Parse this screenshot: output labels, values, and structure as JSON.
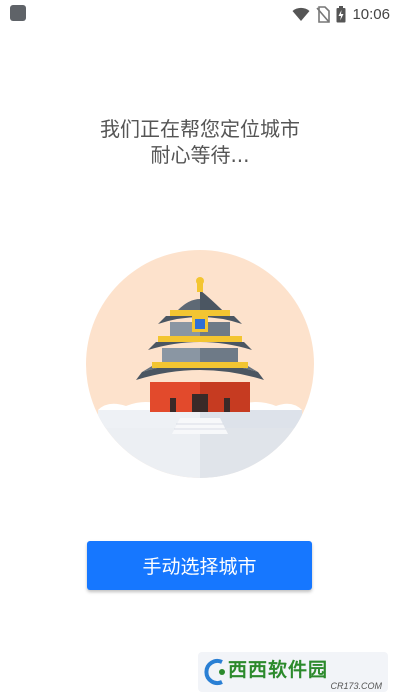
{
  "status_bar": {
    "time": "10:06",
    "icons": [
      "app-notification-icon",
      "wifi-icon",
      "no-sim-icon",
      "battery-charging-icon"
    ]
  },
  "locating": {
    "line1": "我们正在帮您定位城市",
    "line2": "耐心等待..."
  },
  "illustration": {
    "icon": "temple-of-heaven-icon"
  },
  "actions": {
    "manual_select_label": "手动选择城市"
  },
  "watermark": {
    "main_text": "西西软件园",
    "sub_text": "CR173.COM"
  },
  "colors": {
    "primary_button": "#1677ff",
    "message_text": "#555555",
    "illustration_bg": "#fde2cc"
  }
}
